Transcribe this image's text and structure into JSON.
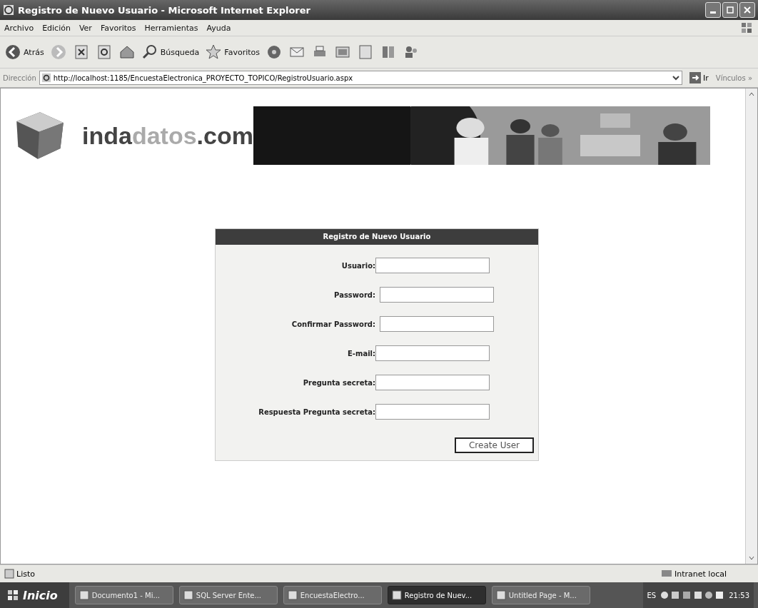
{
  "window": {
    "title": "Registro de Nuevo Usuario - Microsoft Internet Explorer"
  },
  "menu": [
    "Archivo",
    "Edición",
    "Ver",
    "Favoritos",
    "Herramientas",
    "Ayuda"
  ],
  "toolbar": [
    {
      "kind": "back",
      "label": "Atrás"
    },
    {
      "kind": "forward"
    },
    {
      "kind": "stop"
    },
    {
      "kind": "refresh"
    },
    {
      "kind": "home"
    },
    {
      "kind": "search",
      "label": "Búsqueda"
    },
    {
      "kind": "favorites",
      "label": "Favoritos"
    },
    {
      "kind": "media"
    },
    {
      "kind": "mail"
    },
    {
      "kind": "print"
    },
    {
      "kind": "edit"
    },
    {
      "kind": "note"
    },
    {
      "kind": "book"
    },
    {
      "kind": "people"
    }
  ],
  "address_bar": {
    "label": "Dirección",
    "url": "http://localhost:1185/EncuestaElectronica_PROYECTO_TOPICO/RegistroUsuario.aspx",
    "go": "Ir",
    "links": "Vínculos »"
  },
  "logo": [
    {
      "text": "inda",
      "kind": "dark"
    },
    {
      "text": "datos",
      "kind": "light"
    },
    {
      "text": ".com",
      "kind": "dark"
    }
  ],
  "form": {
    "title": "Registro de Nuevo Usuario",
    "fields": [
      {
        "label": "Usuario:"
      },
      {
        "label": "Password:"
      },
      {
        "label": "Confirmar Password:"
      },
      {
        "label": "E-mail:"
      },
      {
        "label": "Pregunta secreta:"
      },
      {
        "label": "Respuesta Pregunta secreta:"
      }
    ],
    "button": "Create User"
  },
  "status_bar": {
    "text": "Listo",
    "zone": "Intranet local"
  },
  "taskbar": {
    "start": "Inicio",
    "items": [
      {
        "label": "Documento1 - Mi...",
        "selected": false
      },
      {
        "label": "SQL Server Ente...",
        "selected": false
      },
      {
        "label": "EncuestaElectro...",
        "selected": false
      },
      {
        "label": "Registro de Nuev...",
        "selected": true
      },
      {
        "label": "Untitled Page - M...",
        "selected": false
      }
    ],
    "language": "ES",
    "clock": "21:53"
  }
}
